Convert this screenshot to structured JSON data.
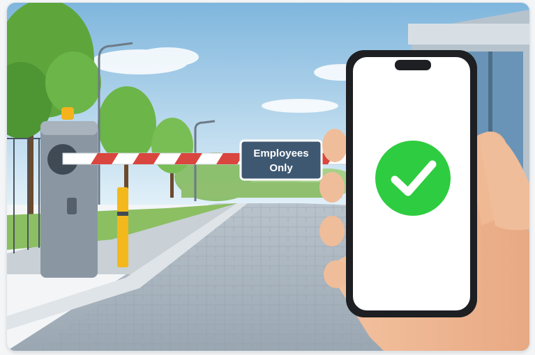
{
  "scene": {
    "sign": {
      "line1": "Employees",
      "line2": "Only"
    }
  },
  "icons": {
    "status": "green-checkmark-icon"
  },
  "colors": {
    "sky_top": "#7fb6dd",
    "sky_bottom": "#d8ecf6",
    "check_green": "#2ecc40",
    "sign_blue": "#3e5872",
    "barrier_red": "#d9463f",
    "post_yellow": "#f2b81c"
  }
}
